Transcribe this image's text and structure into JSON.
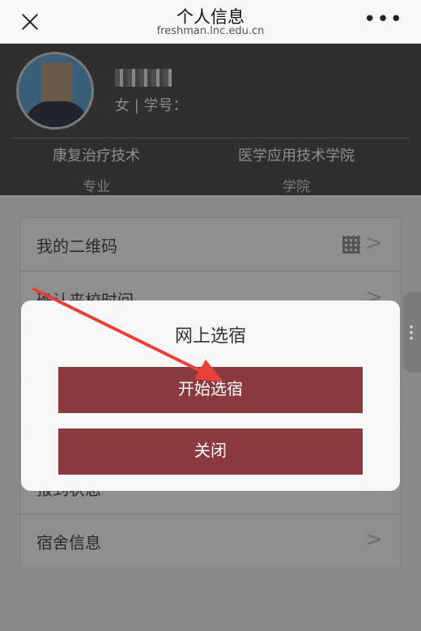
{
  "nav": {
    "title": "个人信息",
    "url": "freshman.lnc.edu.cn",
    "more": "•••"
  },
  "profile": {
    "sub_info": "女 | 学号：",
    "major_value": "康复治疗技术",
    "major_label": "专业",
    "college_value": "医学应用技术学院",
    "college_label": "学院"
  },
  "list": {
    "items": [
      {
        "label": "我的二维码",
        "chevron": ">"
      },
      {
        "label": "确认来校时间",
        "chevron": ">"
      },
      {
        "label": "",
        "chevron": ">"
      },
      {
        "label": "",
        "chevron": ">"
      },
      {
        "label": "报到状态",
        "chevron": ">"
      },
      {
        "label": "宿舍信息",
        "chevron": ">"
      }
    ]
  },
  "modal": {
    "title": "网上选宿",
    "start_label": "开始选宿",
    "close_label": "关闭"
  },
  "colors": {
    "button": "#8b3a3f",
    "arrow": "#e8413a",
    "overlay": "#8a8a8a"
  }
}
